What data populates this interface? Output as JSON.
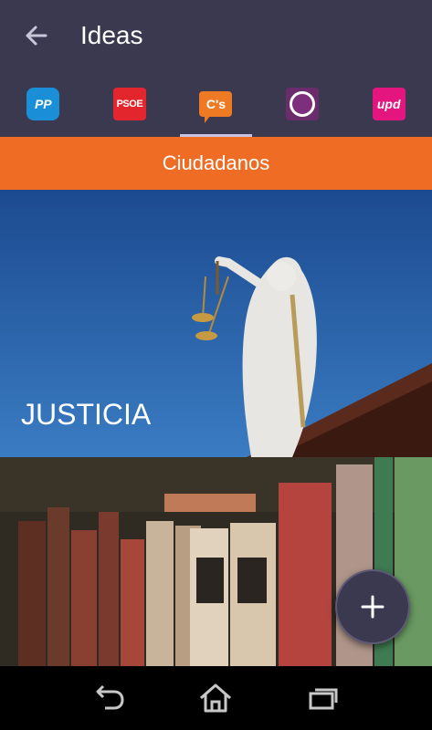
{
  "header": {
    "title": "Ideas"
  },
  "tabs": [
    {
      "logo_text": "PP",
      "name": "pp",
      "color": "#1a8fd8"
    },
    {
      "logo_text": "PSOE",
      "name": "psoe",
      "color": "#e3262d"
    },
    {
      "logo_text": "C's",
      "name": "ciudadanos",
      "color": "#ef7a24",
      "active": true
    },
    {
      "logo_text": "",
      "name": "podemos",
      "color": "#6a2c6b"
    },
    {
      "logo_text": "upd",
      "name": "upyd",
      "color": "#e4157f"
    }
  ],
  "party_bar": {
    "label": "Ciudadanos",
    "color": "#ef6c24"
  },
  "cards": [
    {
      "label": "JUSTICIA"
    },
    {
      "label": ""
    }
  ],
  "fab": {
    "icon": "plus-icon"
  },
  "system_nav": {
    "icons": [
      "back-icon",
      "home-icon",
      "recents-icon"
    ]
  }
}
